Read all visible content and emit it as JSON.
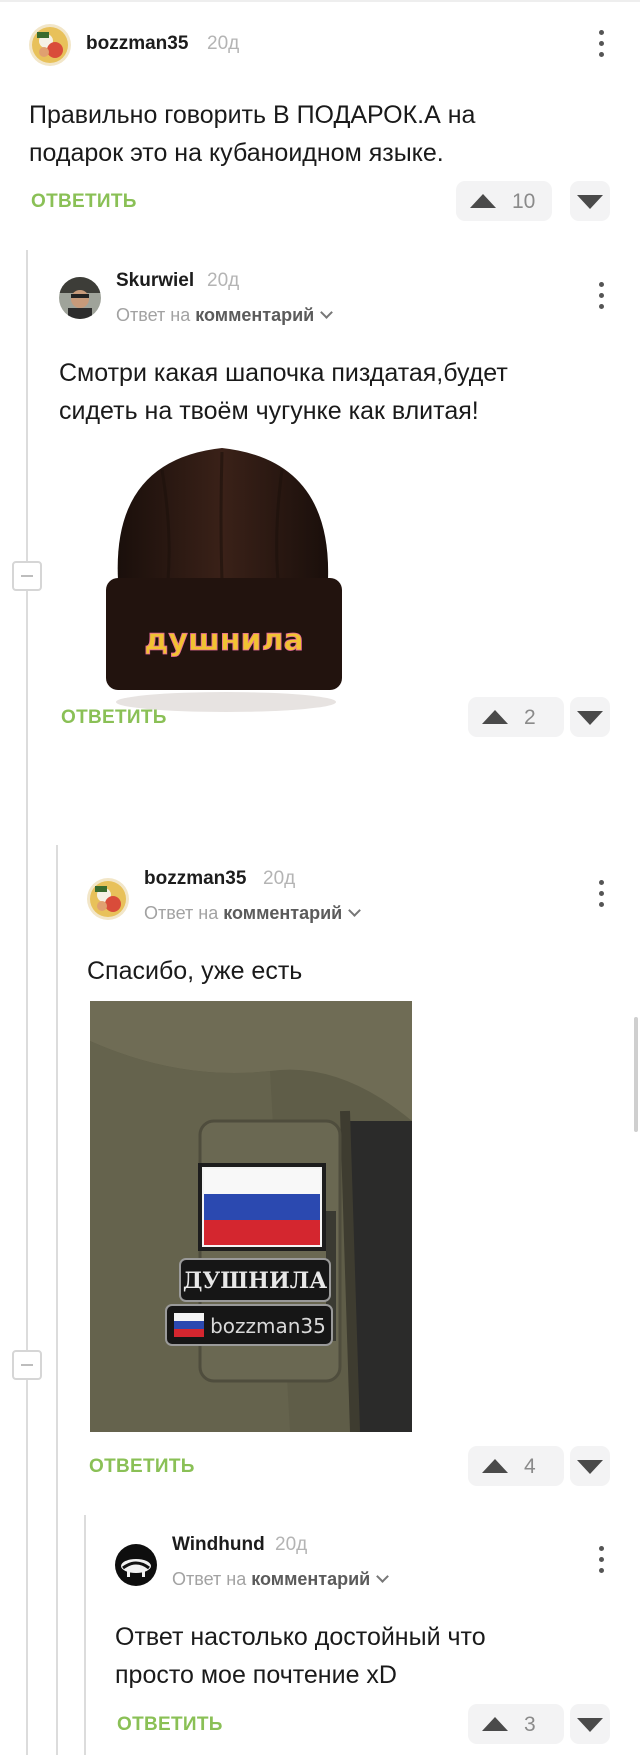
{
  "comments": [
    {
      "user": "bozzman35",
      "age": "20д",
      "text_lines": [
        "Правильно говорить В ПОДАРОК.А на",
        "подарок это на кубаноидном языке."
      ],
      "reply_label": "ОТВЕТИТЬ",
      "votes": "10"
    },
    {
      "user": "Skurwiel",
      "age": "20д",
      "reply_prefix": "Ответ на",
      "reply_target": "комментарий",
      "text_lines": [
        "Смотри какая шапочка пиздатая,будет",
        "сидеть на твоём чугунке как влитая!"
      ],
      "image_text": "душнила",
      "reply_label": "ОТВЕТИТЬ",
      "votes": "2"
    },
    {
      "user": "bozzman35",
      "age": "20д",
      "reply_prefix": "Ответ на",
      "reply_target": "комментарий",
      "text_lines": [
        "Спасибо, уже есть"
      ],
      "image_patch_1": "ДУШНИЛА",
      "image_patch_2": "bozzman35",
      "reply_label": "ОТВЕТИТЬ",
      "votes": "4"
    },
    {
      "user": "Windhund",
      "age": "20д",
      "reply_prefix": "Ответ на",
      "reply_target": "комментарий",
      "text_lines": [
        "Ответ настолько достойный что",
        "просто мое почтение xD"
      ],
      "reply_label": "ОТВЕТИТЬ",
      "votes": "3"
    }
  ]
}
